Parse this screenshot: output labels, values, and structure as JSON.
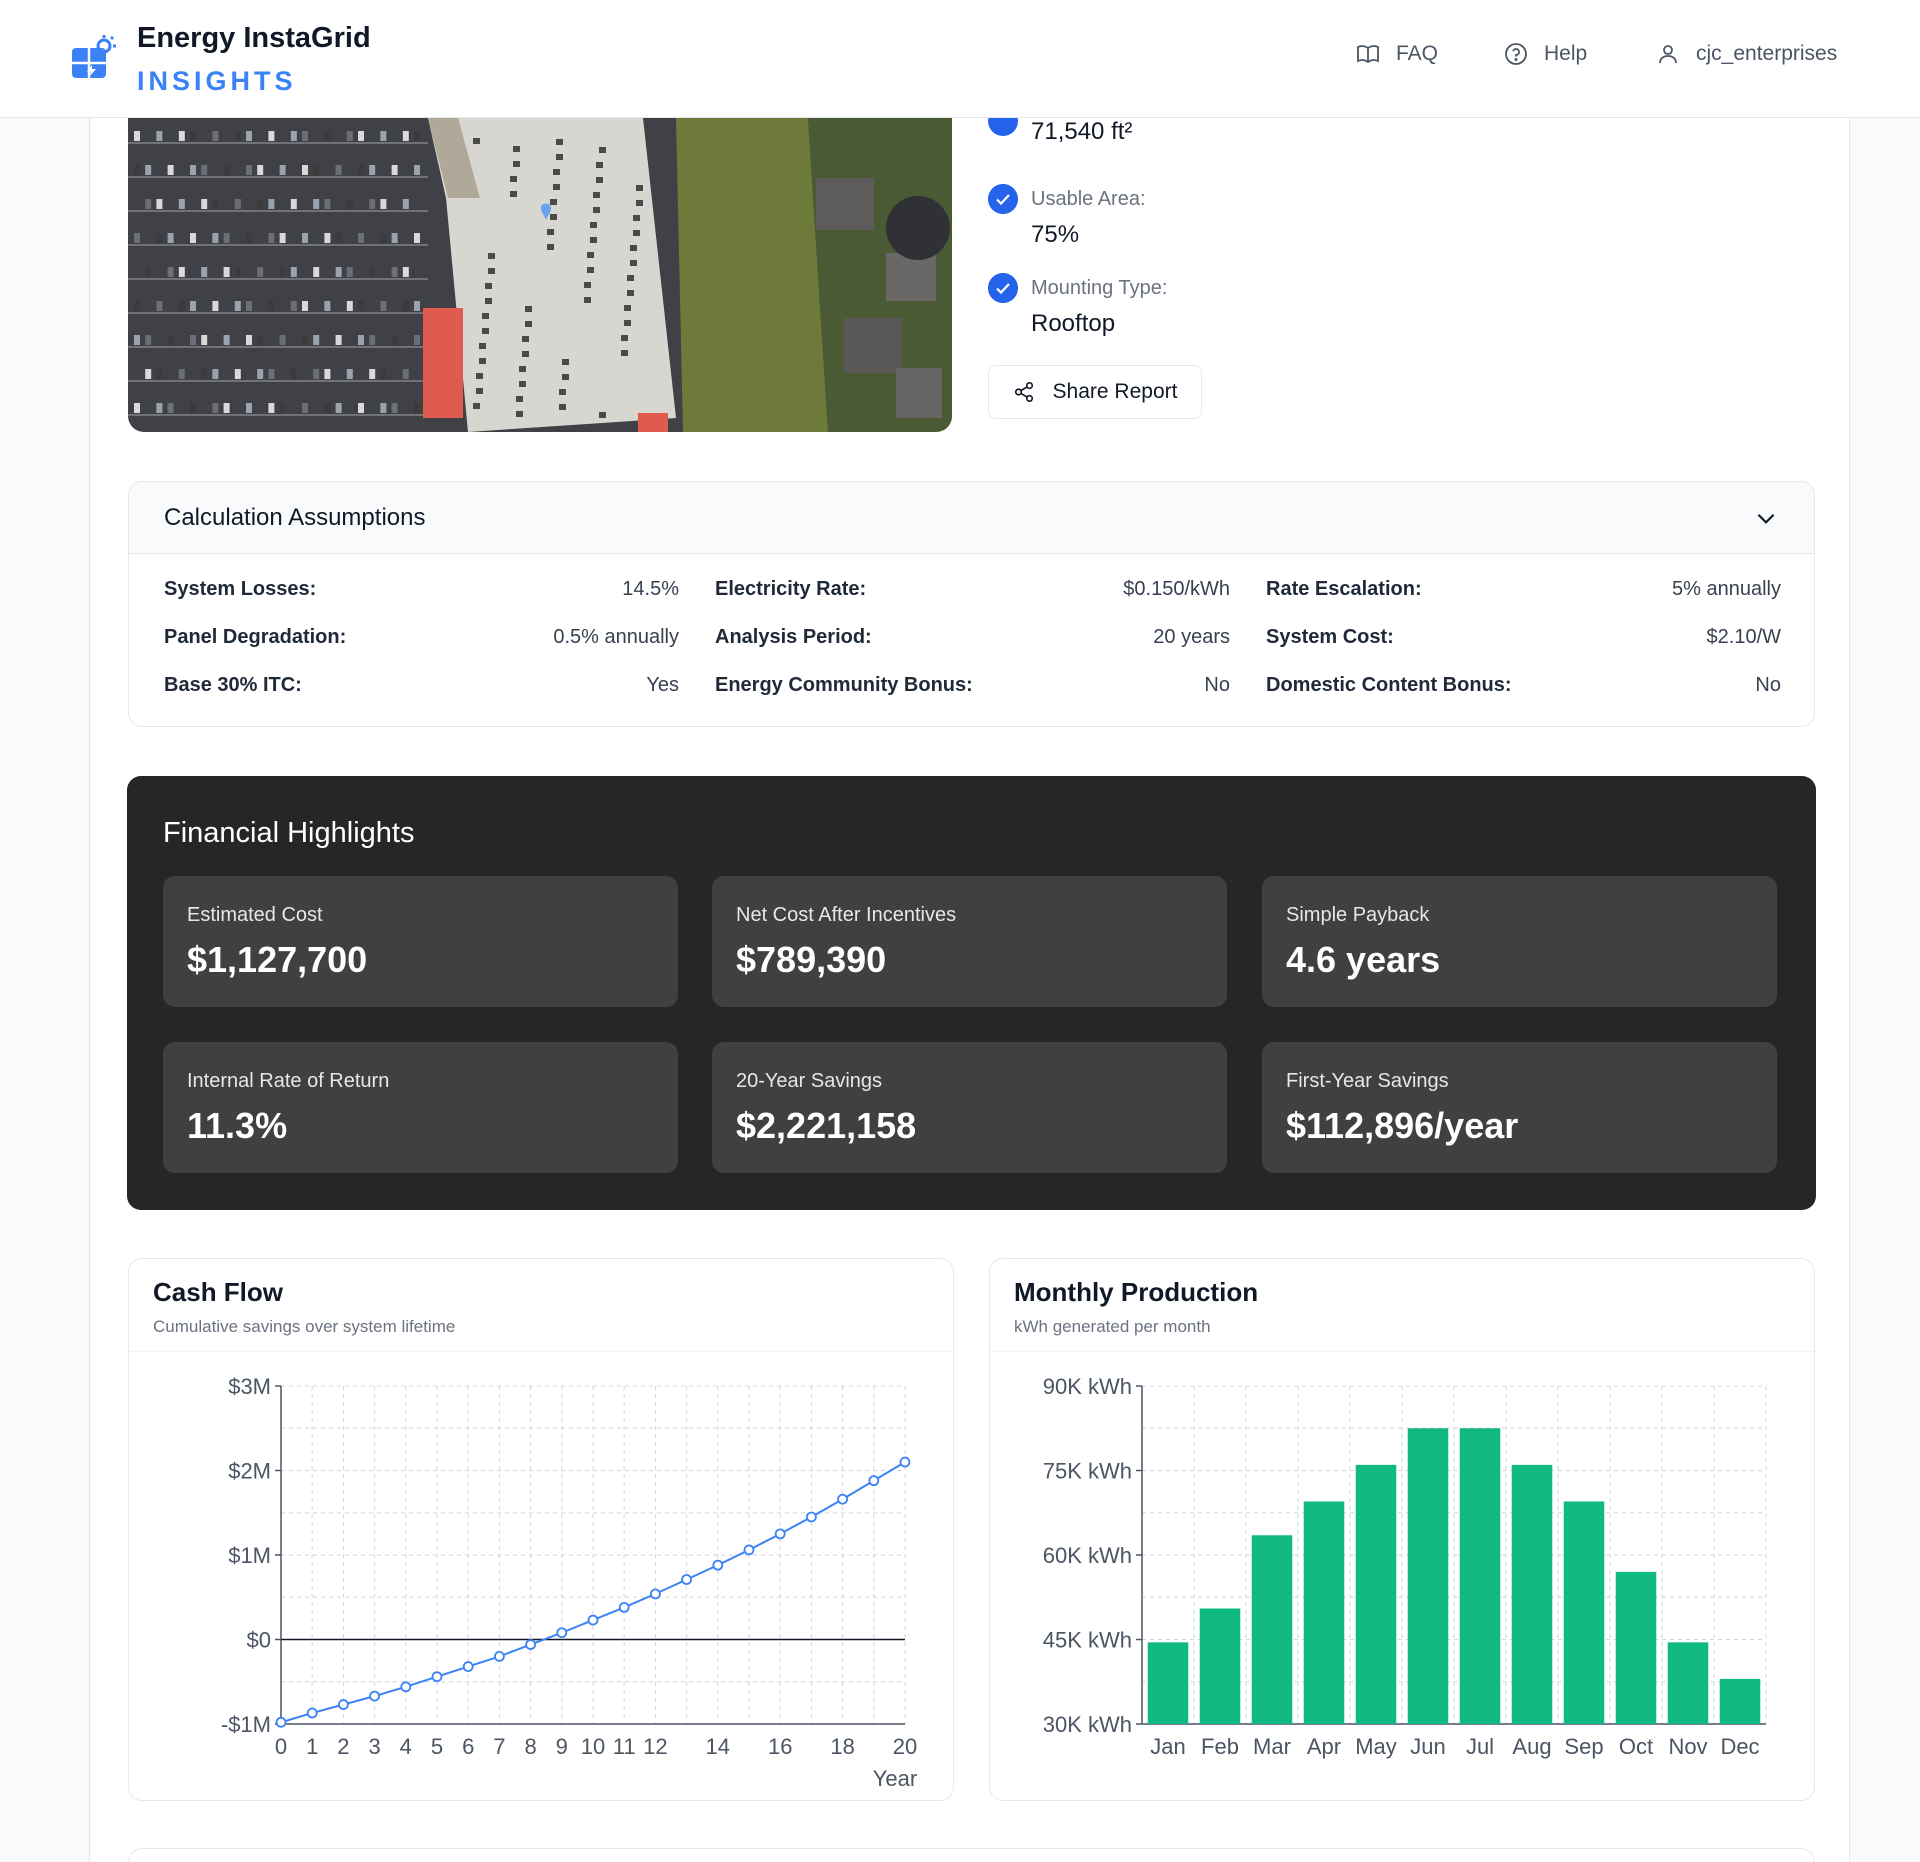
{
  "header": {
    "brand_title": "Energy InstaGrid",
    "brand_sub": "INSIGHTS",
    "nav": {
      "faq": "FAQ",
      "help": "Help",
      "user": "cjc_enterprises"
    }
  },
  "property": {
    "roof_area_value": "71,540 ft²",
    "usable_area_label": "Usable Area:",
    "usable_area_value": "75%",
    "mounting_label": "Mounting Type:",
    "mounting_value": "Rooftop",
    "share_label": "Share Report"
  },
  "assumptions": {
    "title": "Calculation Assumptions",
    "items": [
      {
        "label": "System Losses:",
        "value": "14.5%"
      },
      {
        "label": "Electricity Rate:",
        "value": "$0.150/kWh"
      },
      {
        "label": "Rate Escalation:",
        "value": "5% annually"
      },
      {
        "label": "Panel Degradation:",
        "value": "0.5% annually"
      },
      {
        "label": "Analysis Period:",
        "value": "20 years"
      },
      {
        "label": "System Cost:",
        "value": "$2.10/W"
      },
      {
        "label": "Base 30% ITC:",
        "value": "Yes"
      },
      {
        "label": "Energy Community Bonus:",
        "value": "No"
      },
      {
        "label": "Domestic Content Bonus:",
        "value": "No"
      }
    ]
  },
  "financial": {
    "title": "Financial Highlights",
    "cards": [
      {
        "label": "Estimated Cost",
        "value": "$1,127,700"
      },
      {
        "label": "Net Cost After Incentives",
        "value": "$789,390"
      },
      {
        "label": "Simple Payback",
        "value": "4.6 years"
      },
      {
        "label": "Internal Rate of Return",
        "value": "11.3%"
      },
      {
        "label": "20-Year Savings",
        "value": "$2,221,158"
      },
      {
        "label": "First-Year Savings",
        "value": "$112,896/year"
      }
    ]
  },
  "charts": {
    "cashflow": {
      "title": "Cash Flow",
      "subtitle": "Cumulative savings over system lifetime"
    },
    "monthly": {
      "title": "Monthly Production",
      "subtitle": "kWh generated per month"
    }
  },
  "colors": {
    "accent": "#3b82f6",
    "check": "#2563eb",
    "bar": "#10b981",
    "dark_panel": "#262626",
    "card": "#404040"
  },
  "chart_data": [
    {
      "type": "line",
      "xlabel": "Year",
      "ylim": [
        -1000000,
        3000000
      ],
      "yticks": [
        -1000000,
        0,
        1000000,
        2000000,
        3000000
      ],
      "ytick_labels": [
        "-$1M",
        "$0",
        "$1M",
        "$2M",
        "$3M"
      ],
      "xticks": [
        0,
        1,
        2,
        3,
        4,
        5,
        6,
        7,
        8,
        9,
        10,
        11,
        12,
        14,
        16,
        18,
        20
      ],
      "x": [
        0,
        1,
        2,
        3,
        4,
        5,
        6,
        7,
        8,
        9,
        10,
        11,
        12,
        13,
        14,
        15,
        16,
        17,
        18,
        19,
        20
      ],
      "values": [
        -980000,
        -870000,
        -770000,
        -670000,
        -560000,
        -440000,
        -320000,
        -200000,
        -60000,
        80000,
        230000,
        380000,
        540000,
        710000,
        880000,
        1060000,
        1250000,
        1450000,
        1660000,
        1880000,
        2100000
      ],
      "grid": true
    },
    {
      "type": "bar",
      "ylim": [
        30000,
        90000
      ],
      "yticks": [
        30000,
        45000,
        60000,
        75000,
        90000
      ],
      "ytick_labels": [
        "30K kWh",
        "45K kWh",
        "60K kWh",
        "75K kWh",
        "90K kWh"
      ],
      "categories": [
        "Jan",
        "Feb",
        "Mar",
        "Apr",
        "May",
        "Jun",
        "Jul",
        "Aug",
        "Sep",
        "Oct",
        "Nov",
        "Dec"
      ],
      "values": [
        44500,
        50500,
        63500,
        69500,
        76000,
        82500,
        82500,
        76000,
        69500,
        57000,
        44500,
        38000
      ],
      "grid": true
    }
  ]
}
